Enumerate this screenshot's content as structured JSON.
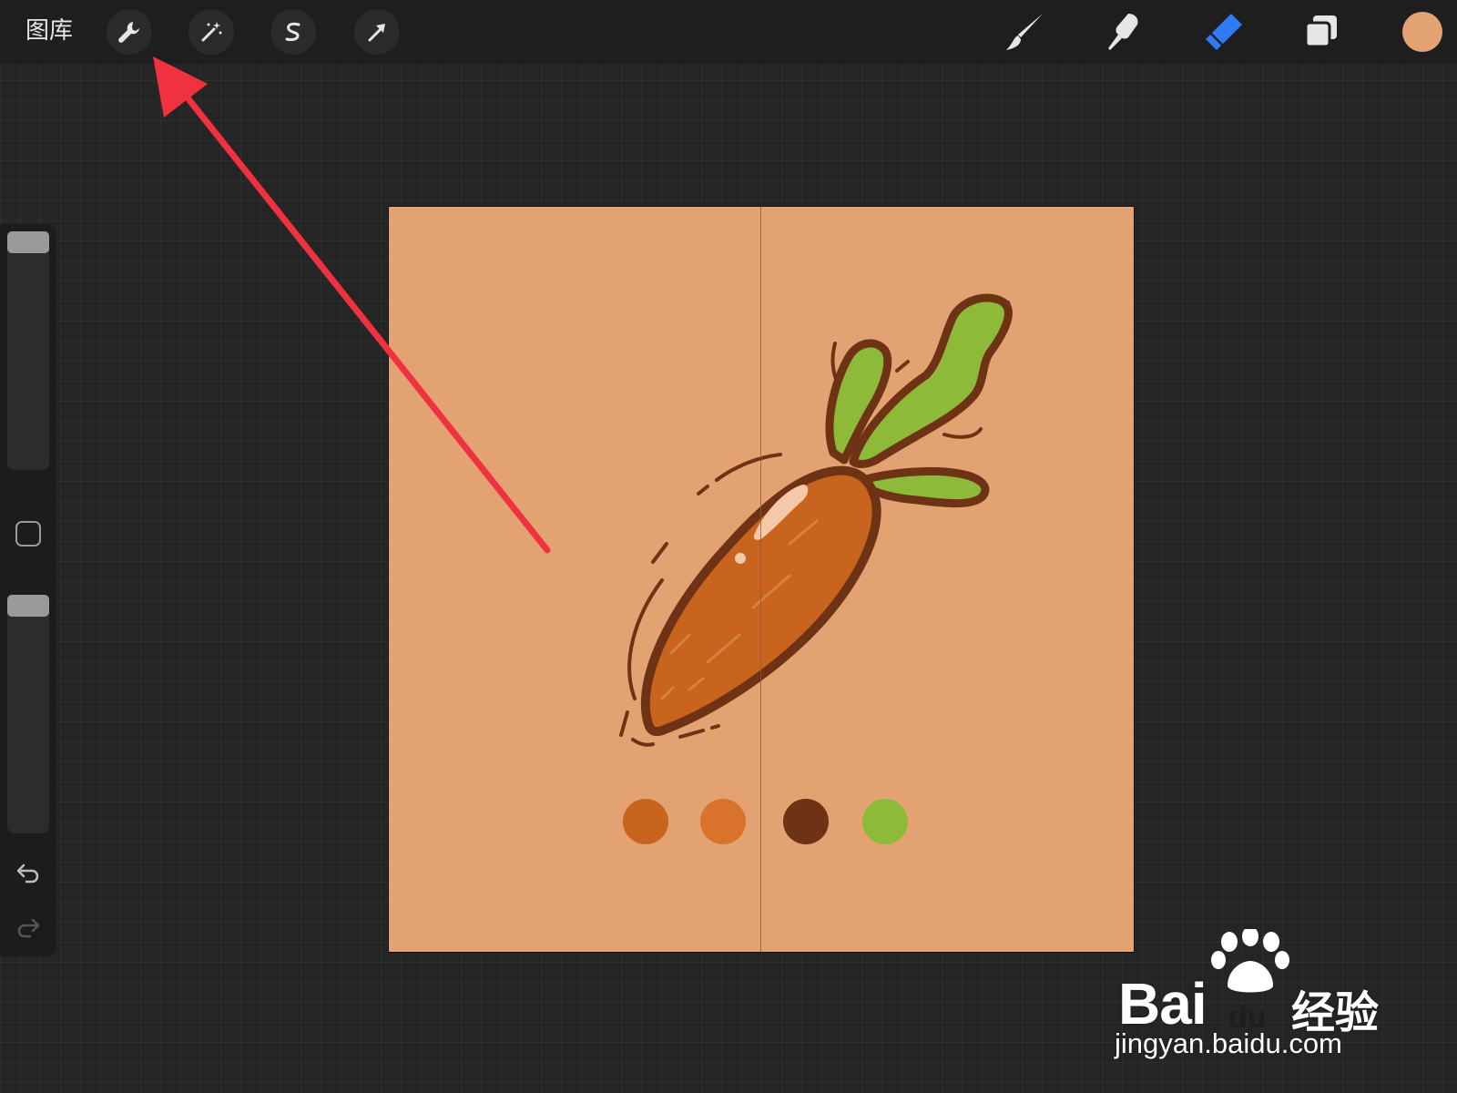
{
  "topbar": {
    "gallery_label": "图库",
    "left_tools": [
      {
        "name": "actions-wrench"
      },
      {
        "name": "adjustments-magic-wand"
      },
      {
        "name": "selection-s"
      },
      {
        "name": "transform-arrow"
      }
    ],
    "right_tools": [
      {
        "name": "brush",
        "active": false
      },
      {
        "name": "smudge",
        "active": false
      },
      {
        "name": "eraser",
        "active": true
      },
      {
        "name": "layers",
        "active": false
      }
    ],
    "current_color": "#E3A271"
  },
  "sidebar": {
    "brush_size_slider": "brush-size",
    "opacity_slider": "brush-opacity",
    "undo_icon": "undo-arrow",
    "redo_icon": "redo-arrow"
  },
  "canvas": {
    "background_color": "#E3A271",
    "symmetry_guide": "vertical",
    "palette_colors": [
      "#C8641E",
      "#D9722A",
      "#6E3215",
      "#8EBA3A"
    ],
    "carrot_colors": {
      "body": "#C8641E",
      "outline": "#6E3215",
      "leaves": "#8EBA3A",
      "highlight": "#F4C8A8"
    }
  },
  "annotation": {
    "arrow_color": "#F0313F",
    "points_to": "actions-wrench"
  },
  "watermark": {
    "brand": "Bai",
    "brand_suffix": "du",
    "cn": "经验",
    "url": "jingyan.baidu.com"
  },
  "colors": {
    "accent_blue": "#2F7BF5",
    "toolbar_bg": "#1E1E1E",
    "workspace_bg": "#252525"
  }
}
